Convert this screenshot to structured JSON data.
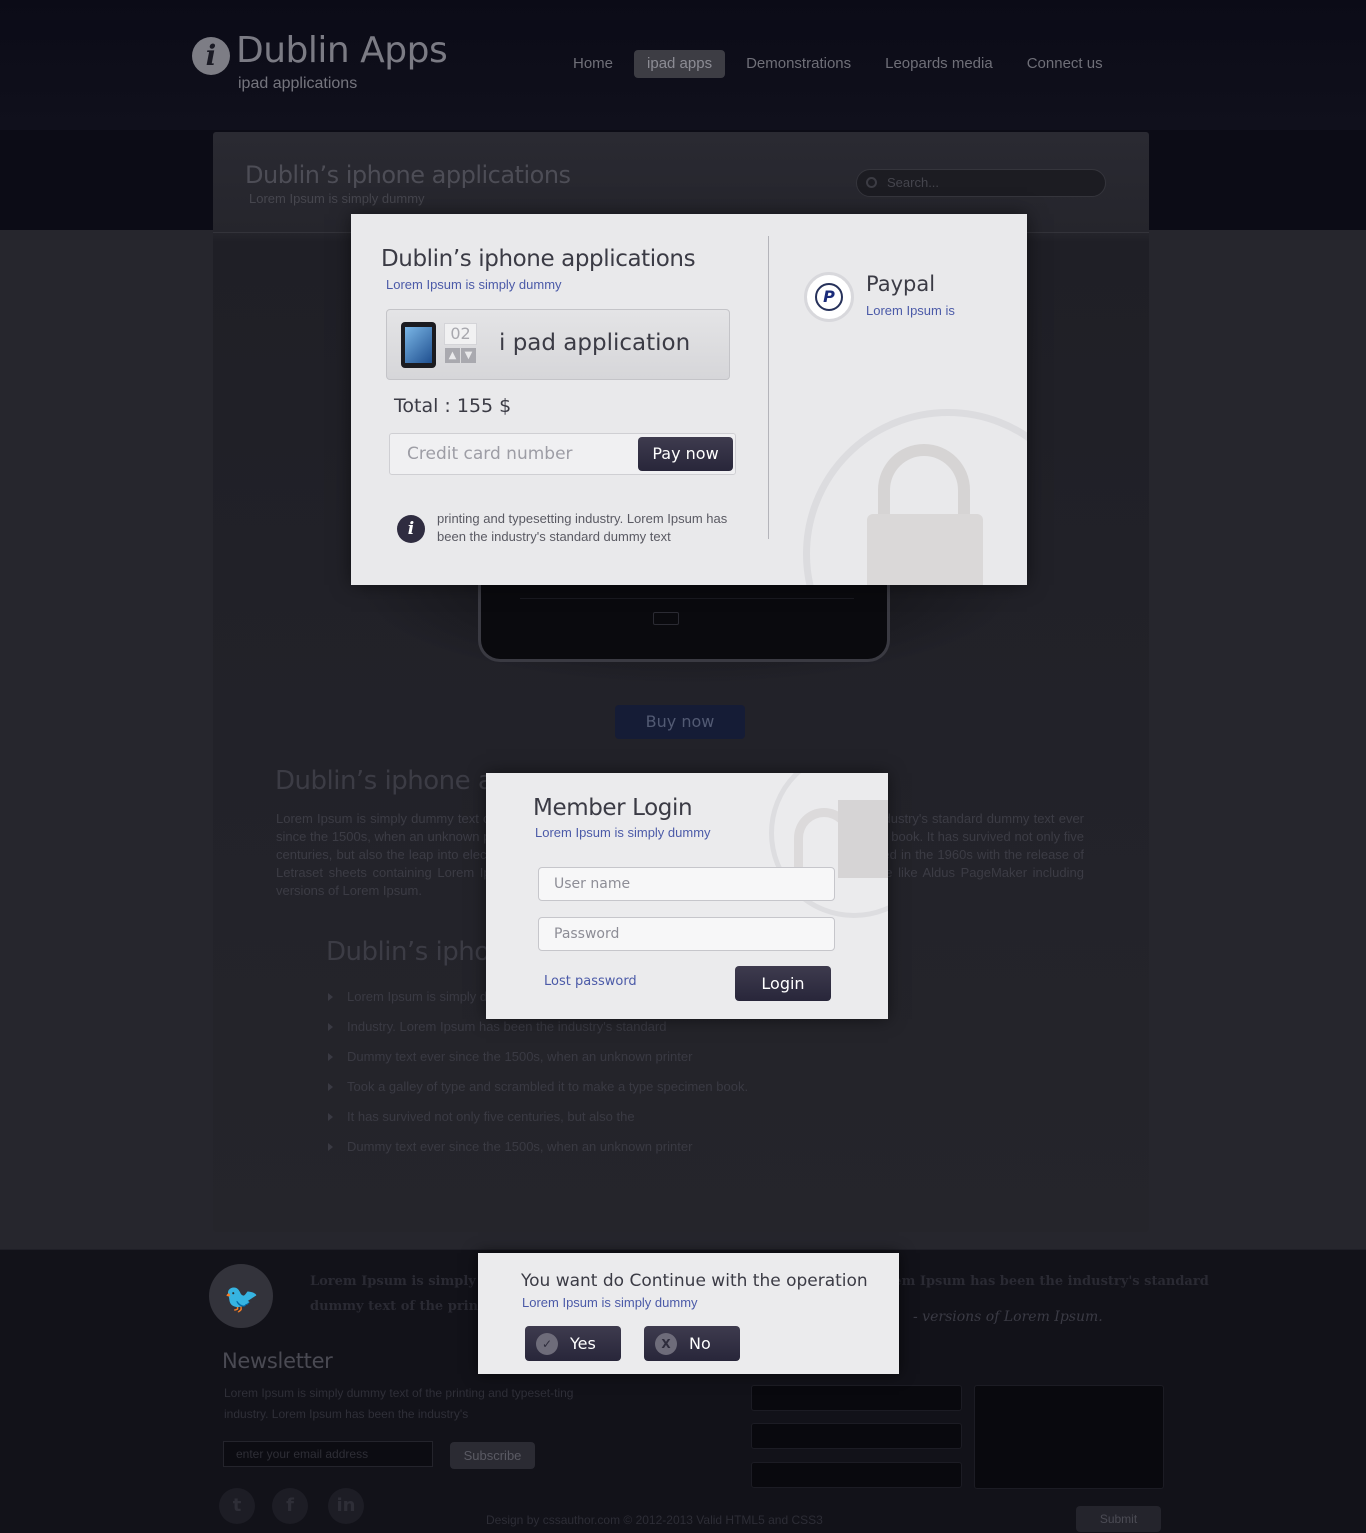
{
  "header": {
    "logo_glyph": "i",
    "title": "Dublin Apps",
    "subtitle": "ipad applications",
    "nav": [
      "Home",
      "ipad apps",
      "Demonstrations",
      "Leopards media",
      "Connect us"
    ]
  },
  "panel": {
    "title": "Dublin’s iphone applications",
    "subtitle": "Lorem Ipsum is simply dummy",
    "search_placeholder": "Search..."
  },
  "buy_now": "Buy now",
  "article": {
    "heading": "Dublin’s iphone a",
    "body": "Lorem Ipsum is simply dummy text of the printing and typesetting industry. Lorem Ipsum has been the industry's standard dummy text ever since the 1500s, when an unknown printer took a galley of type and scrambled it to make a type specimen book. It has survived not only five centuries, but also the leap into electronic typesetting, remaining essentially unchanged. It was popularised in the 1960s with the release of Letraset sheets containing Lorem Ipsum passages, and more recently with desktop publishing software like Aldus PageMaker including versions of Lorem Ipsum.",
    "subheading": "Dublin’s ipho",
    "bullets": [
      "Lorem Ipsum is simply dummy text of the printing",
      "Industry. Lorem Ipsum has been the industry's standard",
      "Dummy text ever since the 1500s, when an unknown printer",
      "Took a galley of type and scrambled it to make a type specimen book.",
      "It has survived not only five centuries, but also the",
      "Dummy text ever since the 1500s, when an unknown printer"
    ]
  },
  "payment_modal": {
    "title": "Dublin’s iphone applications",
    "subtitle": "Lorem Ipsum is simply dummy",
    "quantity": "02",
    "qty_up": "▲",
    "qty_down": "▼",
    "item_name": "i pad application",
    "total": "Total : 155 $",
    "card_placeholder": "Credit card  number",
    "pay_button": "Pay now",
    "info_glyph": "i",
    "info_text": "printing and typesetting industry. Lorem Ipsum has been the industry's standard dummy text",
    "paypal_glyph": "P",
    "paypal_title": "Paypal",
    "paypal_subtitle": "Lorem Ipsum is"
  },
  "login_modal": {
    "title": "Member Login",
    "subtitle": "Lorem Ipsum is simply dummy",
    "username_placeholder": "User name",
    "password_placeholder": "Password",
    "lost_password": "Lost password",
    "login_button": "Login"
  },
  "confirm_modal": {
    "title": "You want do Continue with the operation",
    "subtitle": "Lorem Ipsum is simply dummy",
    "yes_glyph": "✓",
    "yes": "Yes",
    "no_glyph": "X",
    "no": "No"
  },
  "footer": {
    "tweet_line1": "Lorem Ipsum is simply dummy text of the printing and typesetting industry. Lorem Ipsum has been the industry's standard",
    "tweet_line2": "dummy text  of the printing",
    "tweet_attribution": "- versions of Lorem Ipsum.",
    "newsletter_title": "Newsletter",
    "newsletter_text": "Lorem Ipsum is simply dummy text of the printing and typeset-ting industry. Lorem Ipsum has been the industry's",
    "email_placeholder": "enter your email address",
    "subscribe": "Subscribe",
    "social": [
      "t",
      "f",
      "in"
    ],
    "submit": "Submit",
    "copyright": "Design by cssauthor.com © 2012-2013  Valid HTML5 and CSS3"
  }
}
